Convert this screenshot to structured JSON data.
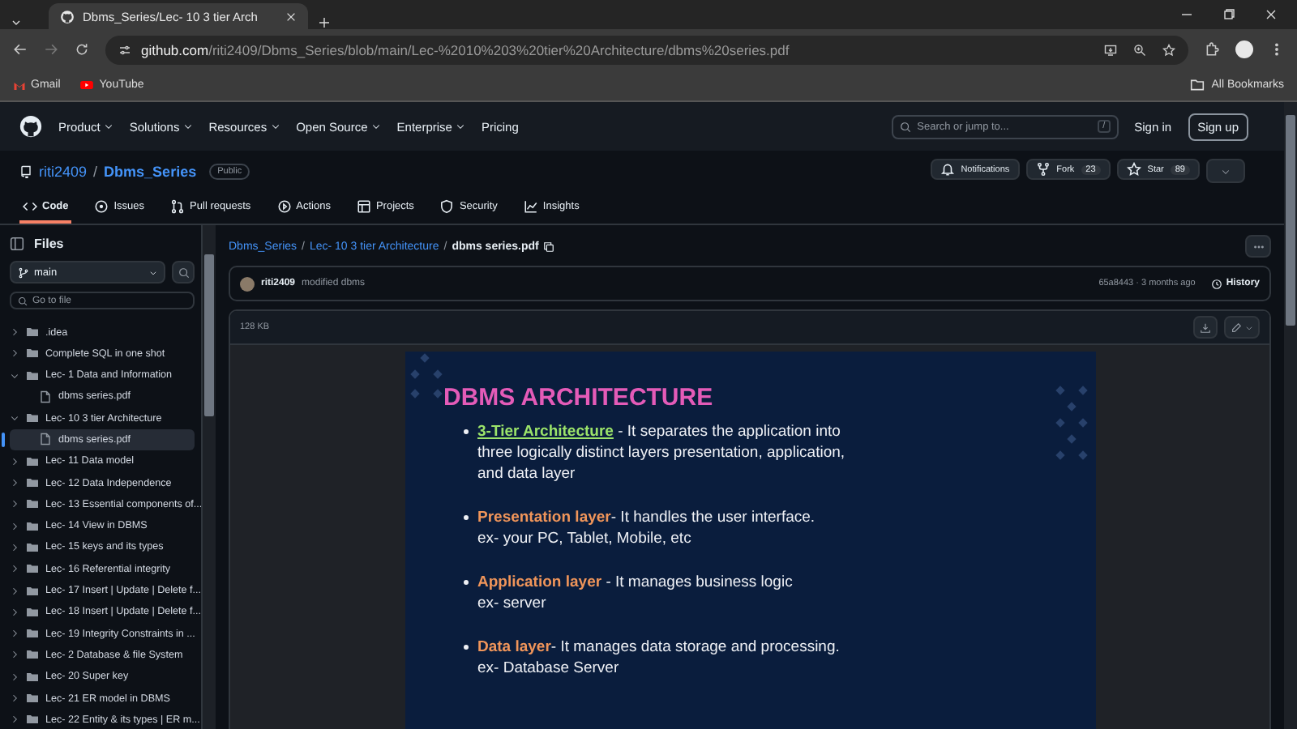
{
  "browser": {
    "tab": {
      "title": "Dbms_Series/Lec- 10 3 tier Arch"
    },
    "url": {
      "host": "github.com",
      "path": "/riti2409/Dbms_Series/blob/main/Lec-%2010%203%20tier%20Architecture/dbms%20series.pdf"
    },
    "bookmarks": [
      "Gmail",
      "YouTube"
    ],
    "all_bookmarks": "All Bookmarks"
  },
  "header": {
    "nav": [
      {
        "label": "Product",
        "has_menu": true
      },
      {
        "label": "Solutions",
        "has_menu": true
      },
      {
        "label": "Resources",
        "has_menu": true
      },
      {
        "label": "Open Source",
        "has_menu": true
      },
      {
        "label": "Enterprise",
        "has_menu": true
      },
      {
        "label": "Pricing",
        "has_menu": false
      }
    ],
    "search": {
      "placeholder": "Search or jump to...",
      "shortcut": "/"
    },
    "sign_in": "Sign in",
    "sign_up": "Sign up"
  },
  "repo": {
    "owner": "riti2409",
    "separator": "/",
    "name": "Dbms_Series",
    "visibility": "Public",
    "actions": [
      {
        "kind": "bell",
        "label": "Notifications"
      },
      {
        "kind": "fork",
        "label": "Fork",
        "count": "23"
      },
      {
        "kind": "star",
        "label": "Star",
        "count": "89"
      }
    ],
    "tabs": [
      {
        "kind": "code",
        "label": "Code",
        "selected": true
      },
      {
        "kind": "issues",
        "label": "Issues",
        "selected": false
      },
      {
        "kind": "pulls",
        "label": "Pull requests",
        "selected": false
      },
      {
        "kind": "actions",
        "label": "Actions",
        "selected": false
      },
      {
        "kind": "projects",
        "label": "Projects",
        "selected": false
      },
      {
        "kind": "security",
        "label": "Security",
        "selected": false
      },
      {
        "kind": "insights",
        "label": "Insights",
        "selected": false
      }
    ]
  },
  "sidebar": {
    "title": "Files",
    "branch": "main",
    "search": {
      "placeholder": "Go to file"
    },
    "tree": [
      {
        "kind": "folder",
        "label": ".idea",
        "expanded": false,
        "selected": false
      },
      {
        "kind": "folder",
        "label": "Complete SQL in one shot",
        "expanded": false,
        "selected": false
      },
      {
        "kind": "folder",
        "label": "Lec- 1 Data and Information",
        "expanded": true,
        "selected": false,
        "children": [
          {
            "kind": "file",
            "label": "dbms series.pdf",
            "selected": false
          }
        ]
      },
      {
        "kind": "folder",
        "label": "Lec- 10 3 tier Architecture",
        "expanded": true,
        "selected": false,
        "children": [
          {
            "kind": "file",
            "label": "dbms series.pdf",
            "selected": true
          }
        ]
      },
      {
        "kind": "folder",
        "label": "Lec- 11 Data model",
        "expanded": false,
        "selected": false
      },
      {
        "kind": "folder",
        "label": "Lec- 12 Data Independence",
        "expanded": false,
        "selected": false
      },
      {
        "kind": "folder",
        "label": "Lec- 13 Essential components of...",
        "expanded": false,
        "selected": false
      },
      {
        "kind": "folder",
        "label": "Lec- 14 View in DBMS",
        "expanded": false,
        "selected": false
      },
      {
        "kind": "folder",
        "label": "Lec- 15 keys and its types",
        "expanded": false,
        "selected": false
      },
      {
        "kind": "folder",
        "label": "Lec- 16 Referential integrity",
        "expanded": false,
        "selected": false
      },
      {
        "kind": "folder",
        "label": "Lec- 17 Insert | Update | Delete f...",
        "expanded": false,
        "selected": false
      },
      {
        "kind": "folder",
        "label": "Lec- 18 Insert | Update | Delete f...",
        "expanded": false,
        "selected": false
      },
      {
        "kind": "folder",
        "label": "Lec- 19 Integrity Constraints in ...",
        "expanded": false,
        "selected": false
      },
      {
        "kind": "folder",
        "label": "Lec- 2 Database & file System",
        "expanded": false,
        "selected": false
      },
      {
        "kind": "folder",
        "label": "Lec- 20 Super key",
        "expanded": false,
        "selected": false
      },
      {
        "kind": "folder",
        "label": "Lec- 21 ER model in DBMS",
        "expanded": false,
        "selected": false
      },
      {
        "kind": "folder",
        "label": "Lec- 22 Entity & its types | ER m...",
        "expanded": false,
        "selected": false
      }
    ]
  },
  "file": {
    "breadcrumb": [
      {
        "label": "Dbms_Series",
        "separator": "/"
      },
      {
        "label": "Lec- 10 3 tier Architecture",
        "separator": "/"
      }
    ],
    "filename": "dbms series.pdf",
    "commit": {
      "author": "riti2409",
      "message": "modified dbms",
      "meta": "65a8443 · 3 months ago",
      "history": "History"
    },
    "size": "128 KB",
    "slide": {
      "title": "DBMS ARCHITECTURE",
      "bullets": [
        {
          "term": "3-Tier Architecture",
          "color": "#9be36a",
          "underlined": true,
          "lines": [
            " - It separates the application into",
            "three logically distinct layers presentation, application,",
            "and data layer"
          ]
        },
        {
          "term": "Presentation layer",
          "color": "#f0955a",
          "underlined": false,
          "lines": [
            "- It handles the user interface.",
            "ex- your PC, Tablet, Mobile, etc"
          ]
        },
        {
          "term": "Application layer",
          "color": "#f0955a",
          "underlined": false,
          "lines": [
            " - It manages business logic",
            "ex- server"
          ]
        },
        {
          "term": "Data layer",
          "color": "#f0955a",
          "underlined": false,
          "lines": [
            "-  It manages data storage and processing.",
            "ex- Database Server"
          ]
        }
      ]
    }
  }
}
